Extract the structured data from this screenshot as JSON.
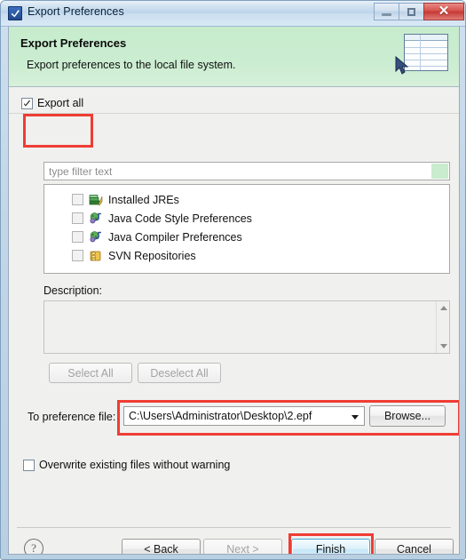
{
  "window": {
    "title": "Export Preferences",
    "icon": "eclipse-wizard-icon",
    "controls": {
      "minimize": "minimize-icon",
      "maximize": "maximize-icon",
      "close": "✕"
    }
  },
  "banner": {
    "title": "Export Preferences",
    "subtitle": "Export preferences to the local file system.",
    "art": "spreadsheet-export-graphic"
  },
  "export_all": {
    "label": "Export all",
    "checked": true
  },
  "filter": {
    "placeholder": "type filter text",
    "value": "",
    "clear_swatch_color": "#c9ecce"
  },
  "tree": {
    "items": [
      {
        "label": "Installed JREs",
        "icon": "jre-books-icon",
        "checked": false
      },
      {
        "label": "Java Code Style Preferences",
        "icon": "java-prefs-icon",
        "checked": false
      },
      {
        "label": "Java Compiler Preferences",
        "icon": "java-prefs-icon",
        "checked": false
      },
      {
        "label": "SVN Repositories",
        "icon": "svn-repository-icon",
        "checked": false
      }
    ]
  },
  "description": {
    "label": "Description:",
    "value": ""
  },
  "select_buttons": {
    "select_all": "Select All",
    "deselect_all": "Deselect All",
    "enabled": false
  },
  "preference_file": {
    "label": "To preference file:",
    "value": "C:\\Users\\Administrator\\Desktop\\2.epf",
    "browse_label": "Browse..."
  },
  "overwrite": {
    "label": "Overwrite existing files without warning",
    "checked": false
  },
  "footer": {
    "help": "?",
    "back": "< Back",
    "next": "Next >",
    "finish": "Finish",
    "cancel": "Cancel"
  },
  "annotations": {
    "color": "#ef3d33",
    "regions": [
      "export-all-checkbox",
      "preference-file-row",
      "finish-button"
    ]
  },
  "colors": {
    "banner_green": "#c9ecce",
    "dialog_bg": "#f0f0ef",
    "titlebar_blue": "#c2d6e8",
    "finish_accent": "#3fa8d4",
    "annotation_red": "#ef3d33"
  }
}
